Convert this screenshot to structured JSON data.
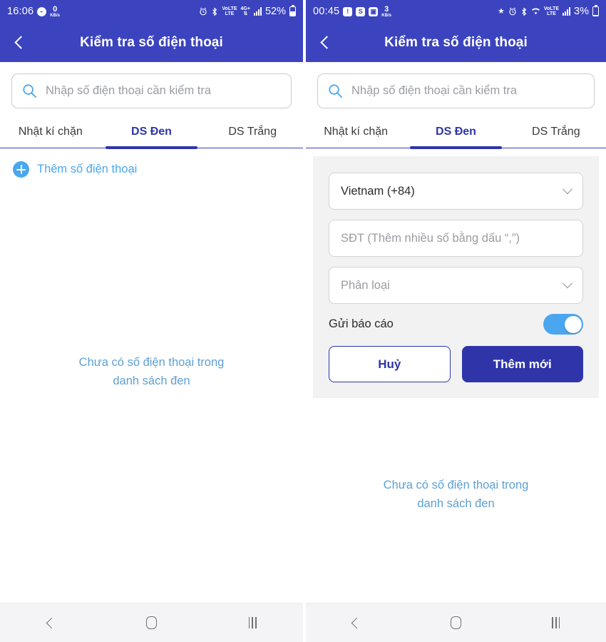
{
  "app": {
    "title": "Kiểm tra số điện thoại",
    "colors": {
      "header_blue": "#3b43bf",
      "accent_blue": "#2f35a8",
      "light_blue": "#4aa7ef",
      "empty_text": "#5e9fd4",
      "card_bg": "#f2f2f3",
      "nav_bg": "#f4f4f6"
    }
  },
  "left": {
    "status": {
      "time": "16:06",
      "messenger_icon": "messenger-icon",
      "net_speed_value": "0",
      "net_speed_unit": "KB/s",
      "alarm_icon": "alarm-icon",
      "bluetooth_icon": "bluetooth-icon",
      "volte_top": "VoLTE",
      "volte_bottom": "LTE",
      "network_top": "4G+",
      "network_bottom": "",
      "signal_icon": "signal-icon",
      "battery_percent": "52%",
      "battery_icon": "battery-icon"
    },
    "appbar": {
      "back_icon": "chevron-left-icon",
      "title": "Kiểm tra số điện thoại"
    },
    "search": {
      "icon": "search-icon",
      "placeholder": "Nhập số điện thoại cần kiểm tra",
      "value": ""
    },
    "tabs": [
      {
        "label": "Nhật kí chặn",
        "active": false
      },
      {
        "label": "DS Đen",
        "active": true
      },
      {
        "label": "DS Trắng",
        "active": false
      }
    ],
    "add_row": {
      "icon": "plus-circle-icon",
      "label": "Thêm số điện thoại"
    },
    "empty_state": {
      "line1": "Chưa có số điện thoại trong",
      "line2": "danh sách đen"
    }
  },
  "right": {
    "status": {
      "time": "00:45",
      "battery_saver_icon": "battery-saver-icon",
      "shopee_icon": "shopee-icon",
      "gallery_icon": "gallery-icon",
      "net_speed_value": "3",
      "net_speed_unit": "KB/s",
      "star_icon": "star-icon",
      "alarm_icon": "alarm-icon",
      "bluetooth_icon": "bluetooth-icon",
      "wifi_icon": "wifi-icon",
      "volte_top": "VoLTE",
      "volte_bottom": "LTE",
      "signal_icon": "signal-icon",
      "battery_percent": "3%",
      "battery_icon": "battery-icon"
    },
    "appbar": {
      "back_icon": "chevron-left-icon",
      "title": "Kiểm tra số điện thoại"
    },
    "search": {
      "icon": "search-icon",
      "placeholder": "Nhập số điện thoại cần kiểm tra",
      "value": ""
    },
    "tabs": [
      {
        "label": "Nhật kí chặn",
        "active": false
      },
      {
        "label": "DS Đen",
        "active": true
      },
      {
        "label": "DS Trắng",
        "active": false
      }
    ],
    "form": {
      "country": {
        "value": "Vietnam (+84)",
        "chevron": "chevron-down-icon"
      },
      "phone": {
        "placeholder": "SĐT (Thêm nhiều số bằng dấu “,”)",
        "value": ""
      },
      "category": {
        "placeholder": "Phân loại",
        "value": "",
        "chevron": "chevron-down-icon"
      },
      "report_toggle": {
        "label": "Gửi báo cáo",
        "on": true
      },
      "cancel_button": "Huỷ",
      "submit_button": "Thêm mới"
    },
    "empty_state": {
      "line1": "Chưa có số điện thoại trong",
      "line2": "danh sách đen"
    }
  },
  "navbar": {
    "back": "nav-back-icon",
    "home": "nav-home-icon",
    "recents": "nav-recents-icon"
  }
}
